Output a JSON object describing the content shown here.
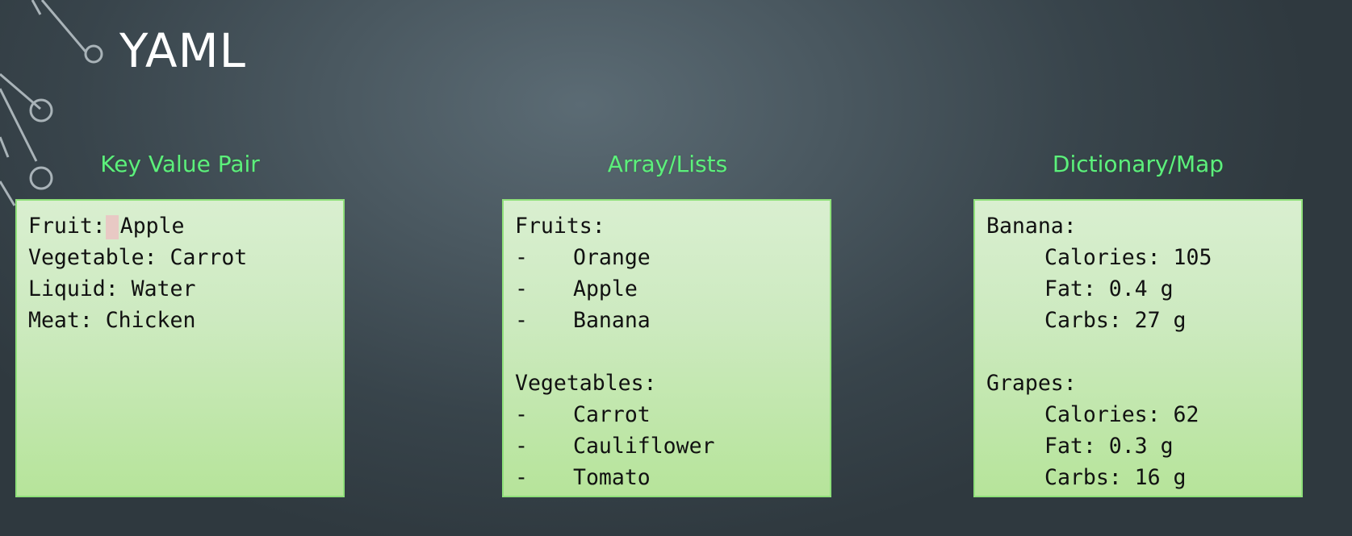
{
  "title": "YAML",
  "columns": {
    "kv": {
      "heading": "Key Value Pair",
      "lines": [
        {
          "key": "Fruit:",
          "value": "Apple"
        },
        {
          "text": "Vegetable: Carrot"
        },
        {
          "text": "Liquid: Water"
        },
        {
          "text": "Meat: Chicken"
        }
      ]
    },
    "arrays": {
      "heading": "Array/Lists",
      "groups": [
        {
          "label": "Fruits:",
          "items": [
            "Orange",
            "Apple",
            "Banana"
          ]
        },
        {
          "label": "Vegetables:",
          "items": [
            "Carrot",
            "Cauliflower",
            "Tomato"
          ]
        }
      ],
      "bullet": "-"
    },
    "dict": {
      "heading": "Dictionary/Map",
      "groups": [
        {
          "label": "Banana:",
          "entries": [
            "Calories: 105",
            "Fat: 0.4 g",
            "Carbs: 27 g"
          ]
        },
        {
          "label": "Grapes:",
          "entries": [
            "Calories: 62",
            "Fat: 0.3 g",
            "Carbs: 16 g"
          ]
        }
      ]
    }
  },
  "colors": {
    "heading": "#5cf07c",
    "box_border": "#8fe07a",
    "title": "#ffffff"
  }
}
